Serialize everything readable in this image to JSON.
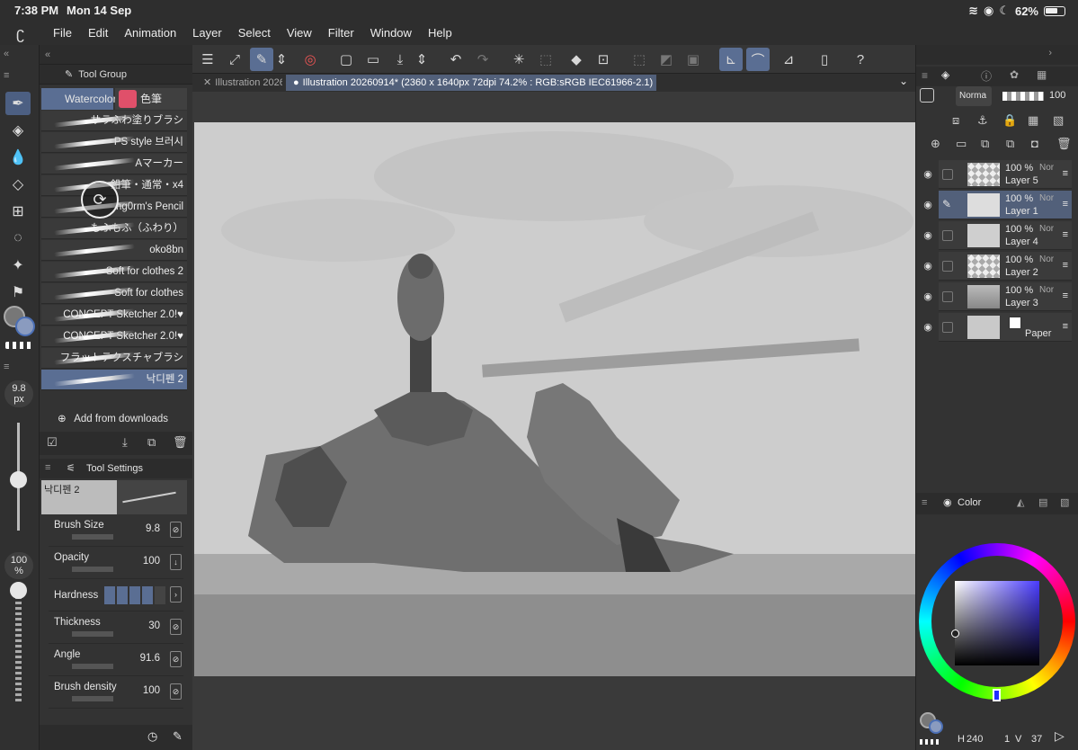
{
  "status": {
    "time": "7:38 PM",
    "date": "Mon 14 Sep",
    "battery": "62%"
  },
  "menu": [
    "File",
    "Edit",
    "Animation",
    "Layer",
    "Select",
    "View",
    "Filter",
    "Window",
    "Help"
  ],
  "tabs": [
    {
      "label": "Illustration 2026"
    },
    {
      "label": "Illustration 20260914* (2360 x 1640px 72dpi 74.2% : RGB:sRGB IEC61966-2.1)"
    }
  ],
  "tool_group": {
    "title": "Tool Group",
    "tabs": [
      "Watercolor",
      "色筆"
    ],
    "brushes": [
      "サラふわ塗りブラシ",
      "PS style 브러시",
      "Aマーカー",
      "鉛筆・通常・x4",
      "ng0rm's Pencil",
      "もふもふ（ふわり）",
      "oko8bn",
      "Soft for clothes 2",
      "Soft for clothes",
      "CONCEPT Sketcher 2.0!♥",
      "CONCEPT Sketcher 2.0!♥",
      "フラットテクスチャブラシ",
      "낙디펜 2"
    ],
    "add_from_downloads": "Add from downloads"
  },
  "tool_settings": {
    "title": "Tool Settings",
    "brush_name": "낙디펜 2",
    "rows": [
      {
        "label": "Brush Size",
        "value": "9.8"
      },
      {
        "label": "Opacity",
        "value": "100"
      },
      {
        "label": "Hardness",
        "value": ""
      },
      {
        "label": "Thickness",
        "value": "30"
      },
      {
        "label": "Angle",
        "value": "91.6"
      },
      {
        "label": "Brush density",
        "value": "100"
      }
    ]
  },
  "left_strip": {
    "size_value": "9.8",
    "size_unit": "px",
    "opacity_value": "100",
    "opacity_unit": "%"
  },
  "layers_panel": {
    "blend_mode": "Norma",
    "opacity": "100",
    "layers": [
      {
        "pct": "100 %",
        "name": "Layer 5",
        "mode": "Nor"
      },
      {
        "pct": "100 %",
        "name": "Layer 1",
        "mode": "Nor"
      },
      {
        "pct": "100 %",
        "name": "Layer 4",
        "mode": "Nor"
      },
      {
        "pct": "100 %",
        "name": "Layer 2",
        "mode": "Nor"
      },
      {
        "pct": "100 %",
        "name": "Layer 3",
        "mode": "Nor"
      },
      {
        "pct": "",
        "name": "Paper",
        "mode": ""
      }
    ]
  },
  "color_panel": {
    "title": "Color",
    "h": "240",
    "s": "1",
    "v": "37"
  },
  "colors": {
    "accent": "#5a6e93",
    "selected_layer": "#52607a"
  }
}
